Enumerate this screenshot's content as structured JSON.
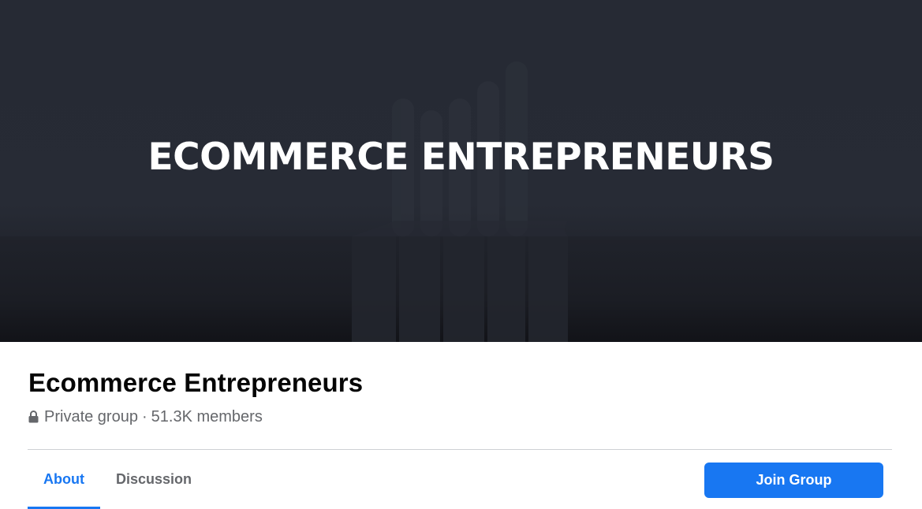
{
  "cover": {
    "title": "ECOMMERCE ENTREPRENEURS"
  },
  "group": {
    "name": "Ecommerce Entrepreneurs",
    "privacy": "Private group",
    "separator": "·",
    "members": "51.3K members",
    "privacy_icon": "lock-icon"
  },
  "tabs": [
    {
      "label": "About",
      "active": true
    },
    {
      "label": "Discussion",
      "active": false
    }
  ],
  "actions": {
    "join_label": "Join Group"
  },
  "colors": {
    "accent": "#1877f2",
    "cover_bg": "#262a34",
    "muted_text": "#65676b"
  }
}
